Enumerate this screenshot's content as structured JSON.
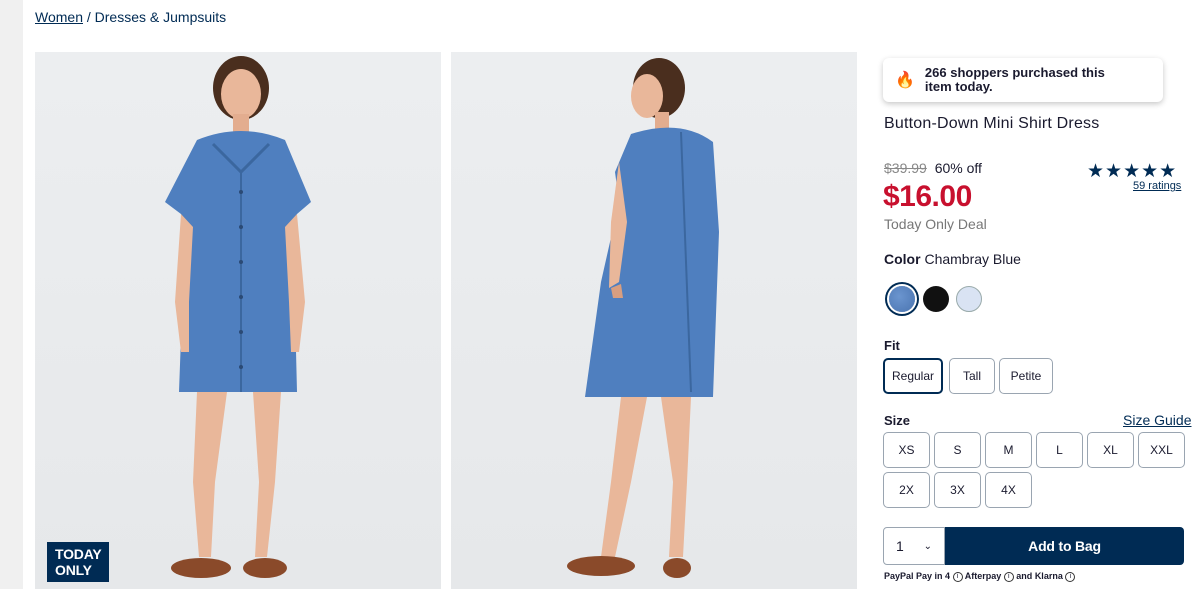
{
  "breadcrumb": {
    "parent": "Women",
    "separator": "/",
    "current": "Dresses & Jumpsuits"
  },
  "badge": {
    "line1": "TODAY",
    "line2": "ONLY"
  },
  "social_proof": {
    "icon": "flame-icon",
    "text": "266 shoppers purchased this item today."
  },
  "product": {
    "title": "Button-Down Mini Shirt Dress",
    "was_price": "$39.99",
    "discount": "60% off",
    "price": "$16.00",
    "deal_label": "Today Only Deal",
    "stars": "★★★★★",
    "rating": 4.5,
    "ratings_link": "59 ratings"
  },
  "color": {
    "label": "Color",
    "selected": "Chambray Blue",
    "swatches": [
      "#5b86c4",
      "#111111",
      "#d9e3f3"
    ]
  },
  "fit": {
    "label": "Fit",
    "options": [
      "Regular",
      "Tall",
      "Petite"
    ],
    "selected": "Regular"
  },
  "size": {
    "label": "Size",
    "guide": "Size Guide",
    "options": [
      "XS",
      "S",
      "M",
      "L",
      "XL",
      "XXL",
      "2X",
      "3X",
      "4X"
    ]
  },
  "purchase": {
    "quantity": "1",
    "add_label": "Add to Bag"
  },
  "payment": {
    "paypal": "PayPal Pay in 4",
    "afterpay": "Afterpay",
    "and": "and",
    "klarna": "Klarna"
  },
  "colors": {
    "brand_navy": "#002b54",
    "sale_red": "#c8102e"
  }
}
